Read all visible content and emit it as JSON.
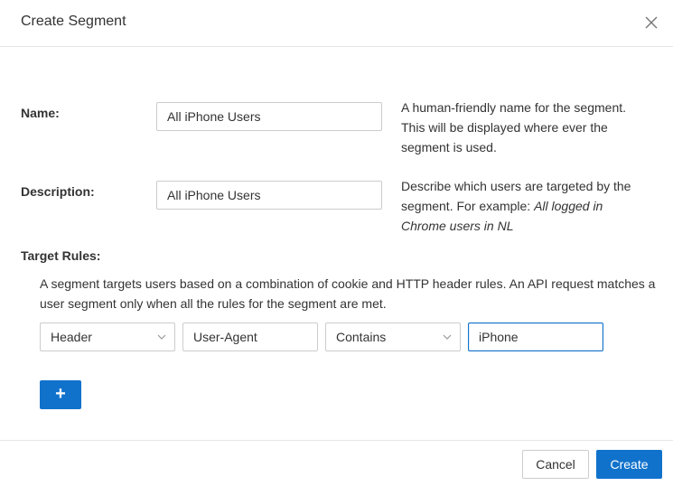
{
  "dialog": {
    "title": "Create Segment",
    "close_icon": "close-icon"
  },
  "form": {
    "name": {
      "label": "Name:",
      "value": "All iPhone Users",
      "help": "A human-friendly name for the segment. This will be displayed where ever the segment is used."
    },
    "description": {
      "label": "Description:",
      "value": "All iPhone Users",
      "help_prefix": "Describe which users are targeted by the segment. For example: ",
      "help_example": "All logged in Chrome users in NL"
    },
    "target_rules": {
      "label": "Target Rules:",
      "intro": "A segment targets users based on a combination of cookie and HTTP header rules. An API request matches a user segment only when all the rules for the segment are met.",
      "rule": {
        "type": "Header",
        "header_name": "User-Agent",
        "operator": "Contains",
        "value": "iPhone"
      },
      "add_label": "+"
    }
  },
  "footer": {
    "cancel_label": "Cancel",
    "create_label": "Create"
  },
  "colors": {
    "primary": "#1172cc",
    "border": "#cccccc",
    "divider": "#e6e6e6",
    "text": "#333333"
  }
}
